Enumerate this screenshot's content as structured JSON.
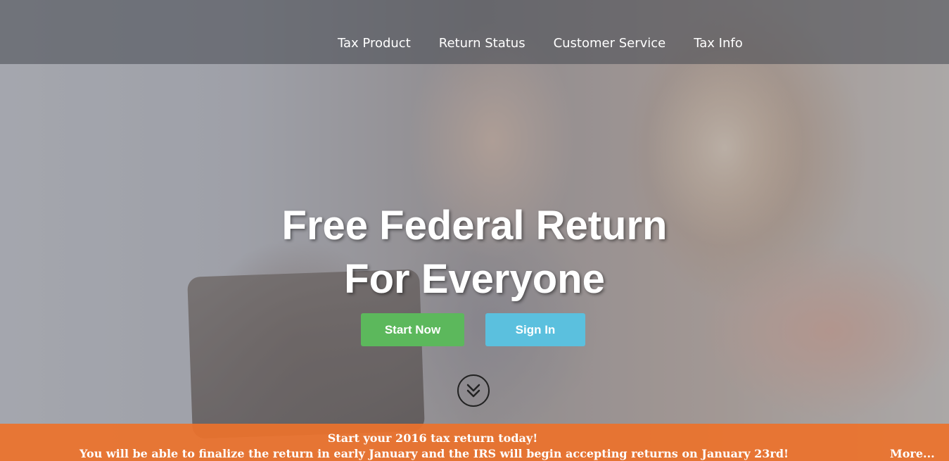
{
  "nav": {
    "items": [
      {
        "label": "Tax Product"
      },
      {
        "label": "Return Status"
      },
      {
        "label": "Customer Service"
      },
      {
        "label": "Tax Info"
      }
    ]
  },
  "hero": {
    "headline_line1": "Free Federal Return",
    "headline_line2": "For Everyone",
    "start_button": "Start Now",
    "signin_button": "Sign In",
    "scroll_icon": "chevron-double-down-icon"
  },
  "promo": {
    "line1": "Start your 2016 tax return today!",
    "line2": "You will be able to finalize the return in early January and the IRS will begin accepting returns on January 23rd!",
    "more_link": "More..."
  },
  "colors": {
    "start_button": "#5cb85c",
    "signin_button": "#5bc0de",
    "promo_bar": "#ec722c"
  }
}
